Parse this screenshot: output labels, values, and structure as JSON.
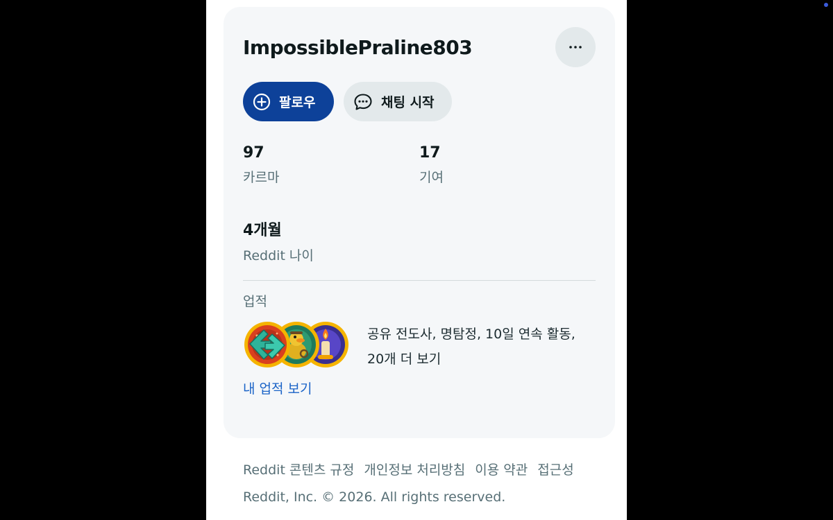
{
  "profile": {
    "username": "ImpossiblePraline803",
    "more_icon": "ellipsis-icon"
  },
  "actions": {
    "follow_label": "팔로우",
    "follow_icon": "plus-circle-icon",
    "chat_label": "채팅 시작",
    "chat_icon": "chat-bubble-icon"
  },
  "stats": {
    "karma": {
      "value": "97",
      "label": "카르마"
    },
    "contributions": {
      "value": "17",
      "label": "기여"
    },
    "age": {
      "value": "4개월",
      "label": "Reddit 나이"
    }
  },
  "achievements": {
    "heading": "업적",
    "badges": [
      "sharing-arrows-badge-icon",
      "detective-duck-badge-icon",
      "candle-streak-badge-icon"
    ],
    "summary_line1": "공유 전도사, 명탐정, 10일 연속 활동,",
    "summary_line2": "20개 더 보기",
    "link_label": "내 업적 보기"
  },
  "footer": {
    "links": [
      "Reddit 콘텐츠 규정",
      "개인정보 처리방침",
      "이용 약관",
      "접근성"
    ],
    "copyright": "Reddit, Inc. © 2026. All rights reserved."
  },
  "colors": {
    "follow_button": "#0d4199",
    "chat_button": "#e3e9eb",
    "card_background": "#f5f7f9",
    "link": "#1a63c7"
  }
}
